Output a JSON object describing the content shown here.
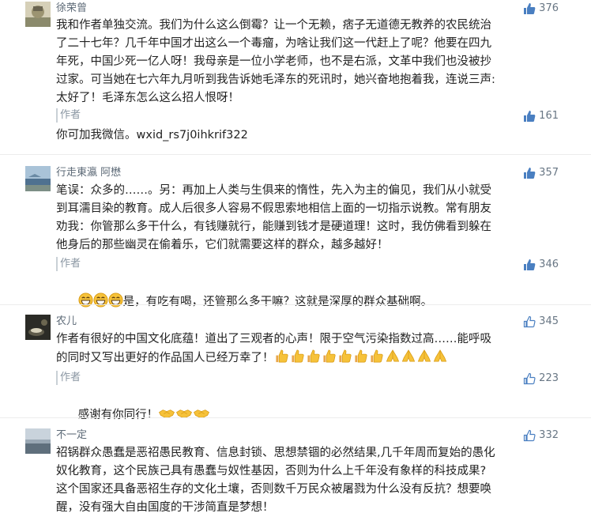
{
  "comments": [
    {
      "author": "徐荣曾",
      "likes": "376",
      "text_lines": [
        "我和作者单独交流。我们为什么这么倒霉？让一个无赖，痞子无道德无教养的农民统治",
        "了二十七年？几千年中国才出这么一个毒瘤，为啥让我们这一代赶上了呢？他要在四九",
        "年死，中国少死一亿人呀！我母亲是一位小学老师，也不是右派，文革中我们也没被抄",
        "过家。可当她在七六年九月听到我告诉她毛泽东的死讯时，她兴奋地抱着我，连说三声:",
        "太好了！毛泽东怎么这么招人恨呀！"
      ],
      "reply": {
        "label": "作者",
        "likes": "161",
        "text": "你可加我微信。wxid_rs7j0ihkrif322"
      }
    },
    {
      "author": "行走東瀛 阿懋",
      "likes": "357",
      "text_lines": [
        "笔误：众多的……。另：再加上人类与生俱来的惰性，先入为主的偏见，我们从小就受",
        "到耳濡目染的教育。成人后很多人容易不假思索地相信上面的一切指示说教。常有朋友",
        "劝我：你管那么多干什么，有钱赚就行，能赚到钱才是硬道理！这时，我仿佛看到躲在",
        "他身后的那些幽灵在偷着乐，它们就需要这样的群众，越多越好！"
      ],
      "reply": {
        "label": "作者",
        "likes": "346",
        "text": "是，有吃有喝，还管那么多干嘛？这就是深厚的群众基础啊。"
      }
    },
    {
      "author": "农儿",
      "likes": "345",
      "text_lines": [
        "作者有很好的中国文化底蕴！道出了三观者的心声！限于空气污染指数过高……能呼吸",
        "的同时又写出更好的作品国人已经万幸了！"
      ],
      "reply": {
        "label": "作者",
        "likes": "223",
        "text": "感谢有你同行！"
      }
    },
    {
      "author": "不一定",
      "likes": "332",
      "text_lines": [
        "祒锅群众愚蠢是恶祒愚民教育、信息封锁、思想禁锢的必然结果,几千年周而复始的愚化",
        "奴化教育，这个民族己具有愚蠢与奴性基因，否则为什么上千年没有象样的科技成果?",
        "这个国家还具备恶祒生存的文化土壤，否则数千万民众被屠戮为什么没有反抗？想要唤",
        "醒，没有强大自由国度的干涉简直是梦想！"
      ]
    }
  ]
}
